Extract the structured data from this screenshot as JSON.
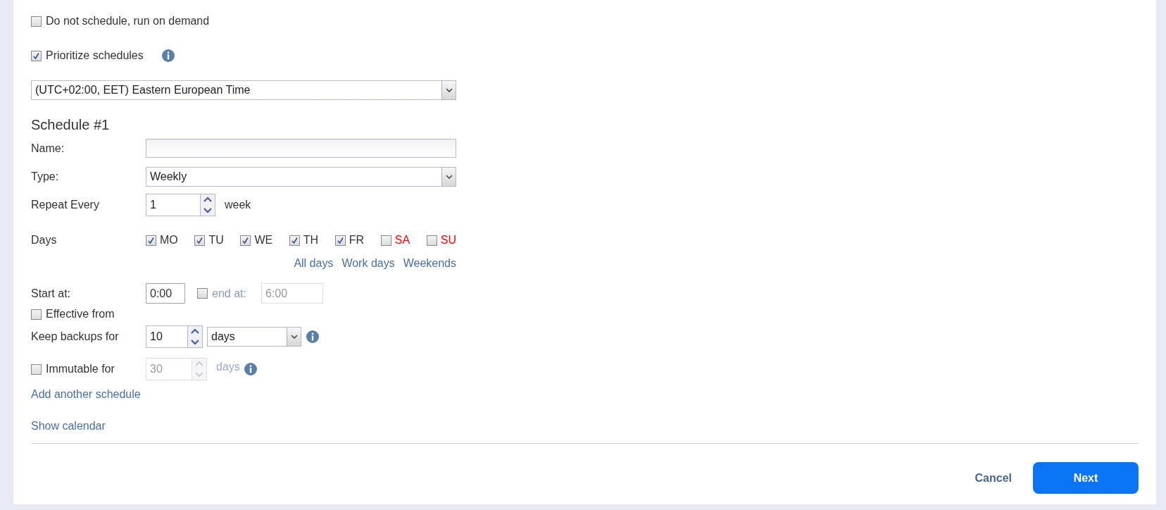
{
  "options": [
    {
      "label": "Do not schedule, run on demand",
      "checked": false,
      "info": false
    },
    {
      "label": "Prioritize schedules",
      "checked": true,
      "info": true
    }
  ],
  "timezone": {
    "value": "(UTC+02:00, EET) Eastern European Time"
  },
  "schedule": {
    "title": "Schedule #1",
    "name": {
      "label": "Name:"
    },
    "type": {
      "label": "Type:",
      "value": "Weekly"
    },
    "repeat": {
      "label": "Repeat Every",
      "value": "1",
      "unit": "week"
    },
    "days": {
      "label": "Days",
      "items": [
        {
          "label": "MO",
          "checked": true,
          "color": "#333333"
        },
        {
          "label": "TU",
          "checked": true,
          "color": "#333333"
        },
        {
          "label": "WE",
          "checked": true,
          "color": "#333333"
        },
        {
          "label": "TH",
          "checked": true,
          "color": "#333333"
        },
        {
          "label": "FR",
          "checked": true,
          "color": "#333333"
        },
        {
          "label": "SA",
          "checked": false,
          "color": "#ff0000"
        },
        {
          "label": "SU",
          "checked": false,
          "color": "#ff0000"
        }
      ],
      "links": [
        "All days",
        "Work days",
        "Weekends"
      ]
    },
    "start": {
      "label": "Start at:",
      "value": "0:00"
    },
    "end": {
      "label": "end at:",
      "checked": false,
      "disabled": true,
      "value": "6:00"
    },
    "effective": {
      "label": "Effective from",
      "checked": false
    },
    "keep": {
      "label": "Keep backups for",
      "value": "10",
      "unit": "days"
    },
    "immutable": {
      "label": "Immutable for",
      "checked": false,
      "disabled": true,
      "value": "30",
      "unit": "days"
    }
  },
  "links": [
    "Add another schedule",
    "Show calendar"
  ],
  "buttons": {
    "cancel": "Cancel",
    "next": "Next"
  }
}
